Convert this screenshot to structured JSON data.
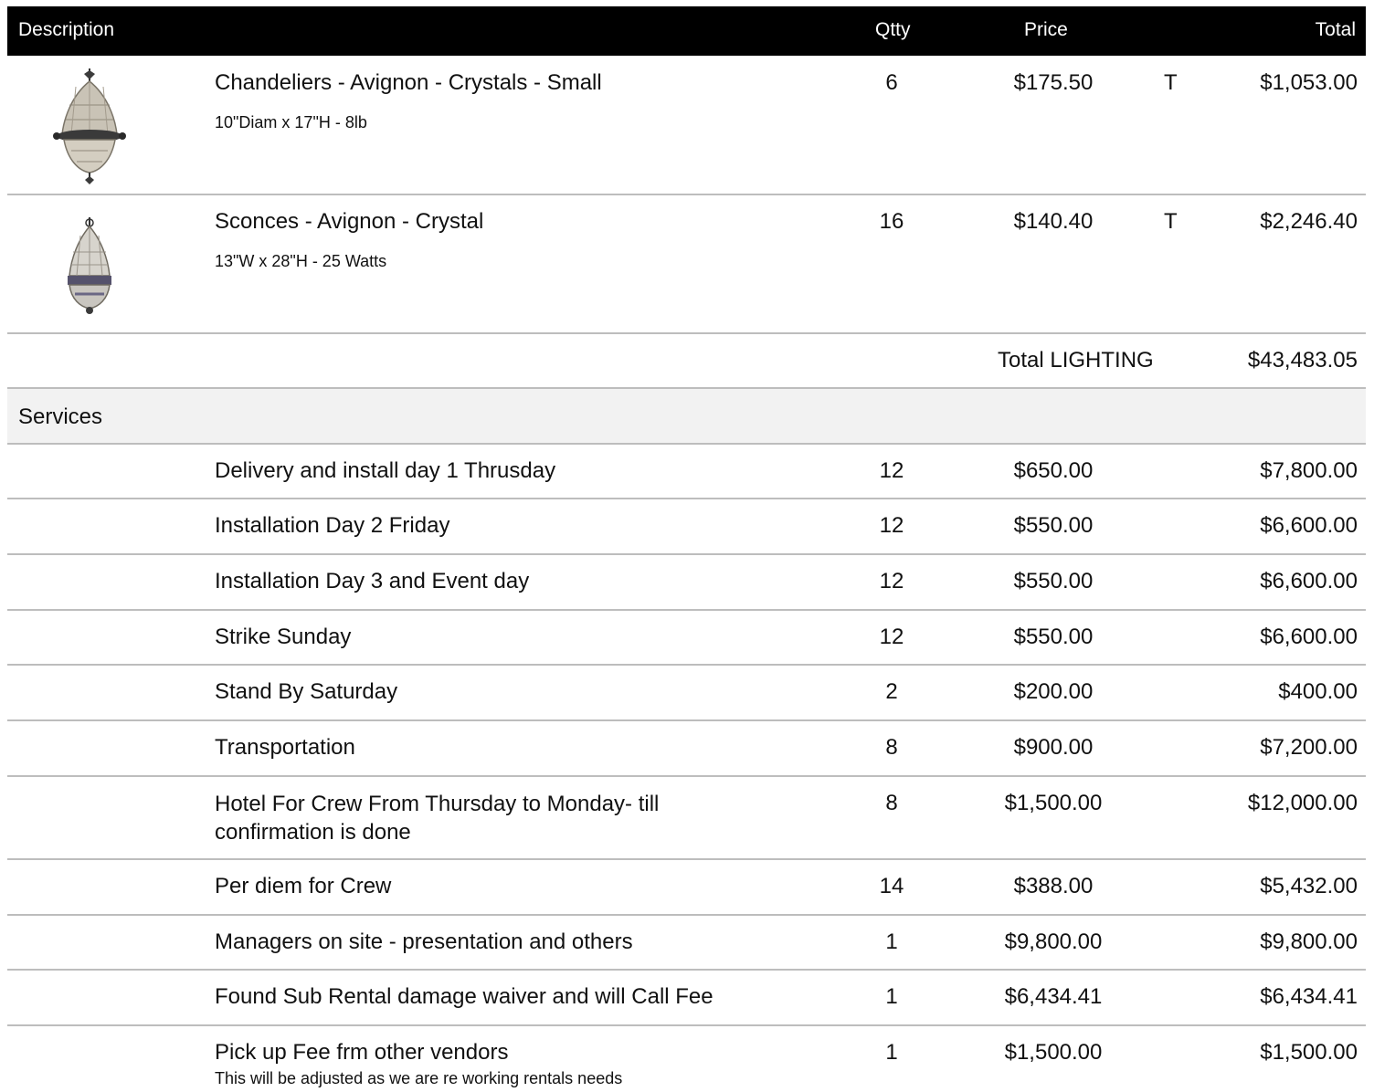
{
  "header": {
    "description": "Description",
    "qty": "Qtty",
    "price": "Price",
    "total": "Total"
  },
  "lighting_items": [
    {
      "name": "Chandeliers - Avignon - Crystals - Small",
      "details": "10\"Diam x 17\"H - 8lb",
      "qty": "6",
      "price": "$175.50",
      "tax": "T",
      "total": "$1,053.00"
    },
    {
      "name": "Sconces - Avignon - Crystal",
      "details": "13\"W x 28\"H - 25 Watts",
      "qty": "16",
      "price": "$140.40",
      "tax": "T",
      "total": "$2,246.40"
    }
  ],
  "lighting_total": {
    "label": "Total LIGHTING",
    "value": "$43,483.05"
  },
  "services_section": {
    "label": "Services"
  },
  "services": [
    {
      "name": "Delivery and install day 1 Thrusday",
      "qty": "12",
      "price": "$650.00",
      "total": "$7,800.00"
    },
    {
      "name": "Installation Day 2 Friday",
      "qty": "12",
      "price": "$550.00",
      "total": "$6,600.00"
    },
    {
      "name": "Installation Day 3 and Event day",
      "qty": "12",
      "price": "$550.00",
      "total": "$6,600.00"
    },
    {
      "name": "Strike Sunday",
      "qty": "12",
      "price": "$550.00",
      "total": "$6,600.00"
    },
    {
      "name": "Stand By Saturday",
      "qty": "2",
      "price": "$200.00",
      "total": "$400.00"
    },
    {
      "name": "Transportation",
      "qty": "8",
      "price": "$900.00",
      "total": "$7,200.00"
    },
    {
      "name": "Hotel For Crew From Thursday to Monday- till confirmation is done",
      "qty": "8",
      "price": "$1,500.00",
      "total": "$12,000.00"
    },
    {
      "name": "Per diem for Crew",
      "qty": "14",
      "price": "$388.00",
      "total": "$5,432.00"
    },
    {
      "name": "Managers on site - presentation and others",
      "qty": "1",
      "price": "$9,800.00",
      "total": "$9,800.00"
    },
    {
      "name": "Found Sub Rental damage waiver and will Call Fee",
      "qty": "1",
      "price": "$6,434.41",
      "total": "$6,434.41"
    },
    {
      "name": "Pick up Fee frm other vendors",
      "note": "This will be adjusted as we are re working rentals needs",
      "qty": "1",
      "price": "$1,500.00",
      "total": "$1,500.00"
    }
  ]
}
